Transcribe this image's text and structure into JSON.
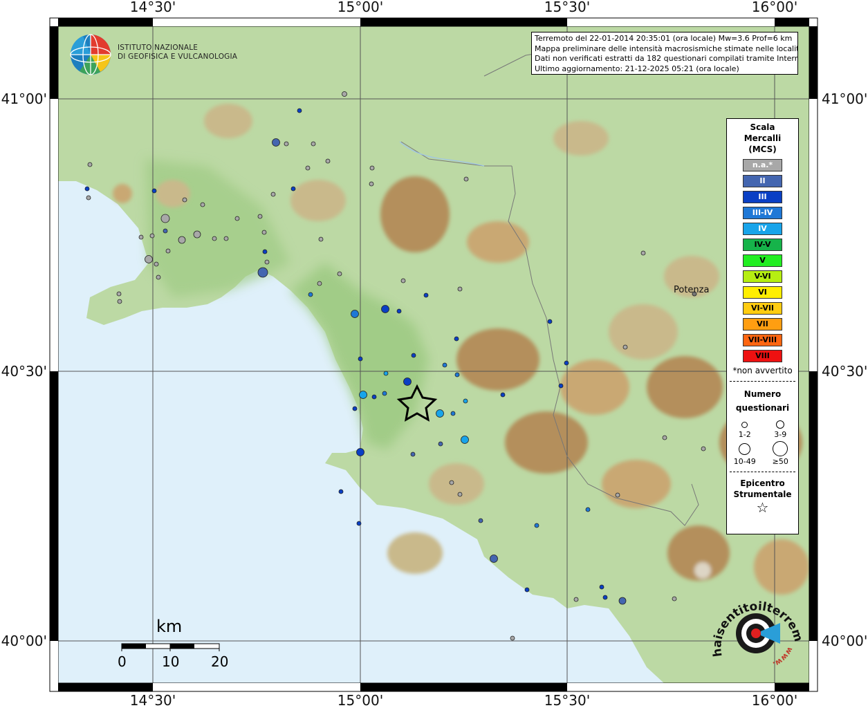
{
  "map": {
    "lon_ticks_top": [
      "14°30'",
      "15°00'",
      "15°30'",
      "16°00'"
    ],
    "lon_ticks_bottom": [
      "14°30'",
      "15°00'",
      "15°30'",
      "16°00'"
    ],
    "lat_ticks": [
      "41°00'",
      "40°30'",
      "40°00'"
    ],
    "colors": {
      "sea": "#dff0fa",
      "land": "#bcd9a4",
      "lowland": "#9fcb84",
      "hills": "#c9b98b",
      "mountains": "#b48f5c",
      "peaks": "#ddd5c5",
      "frame": "#000000"
    }
  },
  "logo": {
    "line1": "ISTITUTO NAZIONALE",
    "line2": "DI GEOFISICA E VULCANOLOGIA",
    "icon": "globe-logo-icon"
  },
  "info": {
    "line1": "Terremoto del 22-01-2014 20:35:01 (ora locale) Mw=3.6 Prof=6 km",
    "line2": "Mappa preliminare delle intensità macrosismiche stimate nelle località",
    "line3": "Dati non verificati estratti da 182 questionari compilati tramite Internet.",
    "line4": "Ultimo aggiornamento: 21-12-2025 05:21 (ora locale)"
  },
  "legend": {
    "title1": "Scala",
    "title2": "Mercalli",
    "title3": "(MCS)",
    "items": [
      {
        "label": "n.a.*",
        "color": "#a8a8a8",
        "text": "#ffffff"
      },
      {
        "label": "II",
        "color": "#4466b0",
        "text": "#ffffff"
      },
      {
        "label": "III",
        "color": "#0a3fc4",
        "text": "#ffffff"
      },
      {
        "label": "III-IV",
        "color": "#1f78d6",
        "text": "#ffffff"
      },
      {
        "label": "IV",
        "color": "#18a4ea",
        "text": "#ffffff"
      },
      {
        "label": "IV-V",
        "color": "#16b34a",
        "text": "#000000"
      },
      {
        "label": "V",
        "color": "#22ee22",
        "text": "#000000"
      },
      {
        "label": "V-VI",
        "color": "#b6ee12",
        "text": "#000000"
      },
      {
        "label": "VI",
        "color": "#ffee00",
        "text": "#000000"
      },
      {
        "label": "VI-VII",
        "color": "#ffcc11",
        "text": "#000000"
      },
      {
        "label": "VII",
        "color": "#ff9e11",
        "text": "#000000"
      },
      {
        "label": "VII-VIII",
        "color": "#ff6611",
        "text": "#000000"
      },
      {
        "label": "VIII",
        "color": "#ee1111",
        "text": "#000000"
      }
    ],
    "note": "*non avvertito",
    "count_title1": "Numero",
    "count_title2": "questionari",
    "sizes": [
      "1-2",
      "3-9",
      "10-49",
      "≥50"
    ],
    "epi_title1": "Epicentro",
    "epi_title2": "Strumentale"
  },
  "places": {
    "potenza": "Potenza"
  },
  "scale": {
    "unit": "km",
    "labels": [
      "0",
      "10",
      "20"
    ]
  },
  "badge": {
    "text": "haisentitoilterremoto.it",
    "url": "www.",
    "icon": "target-logo-icon"
  }
}
